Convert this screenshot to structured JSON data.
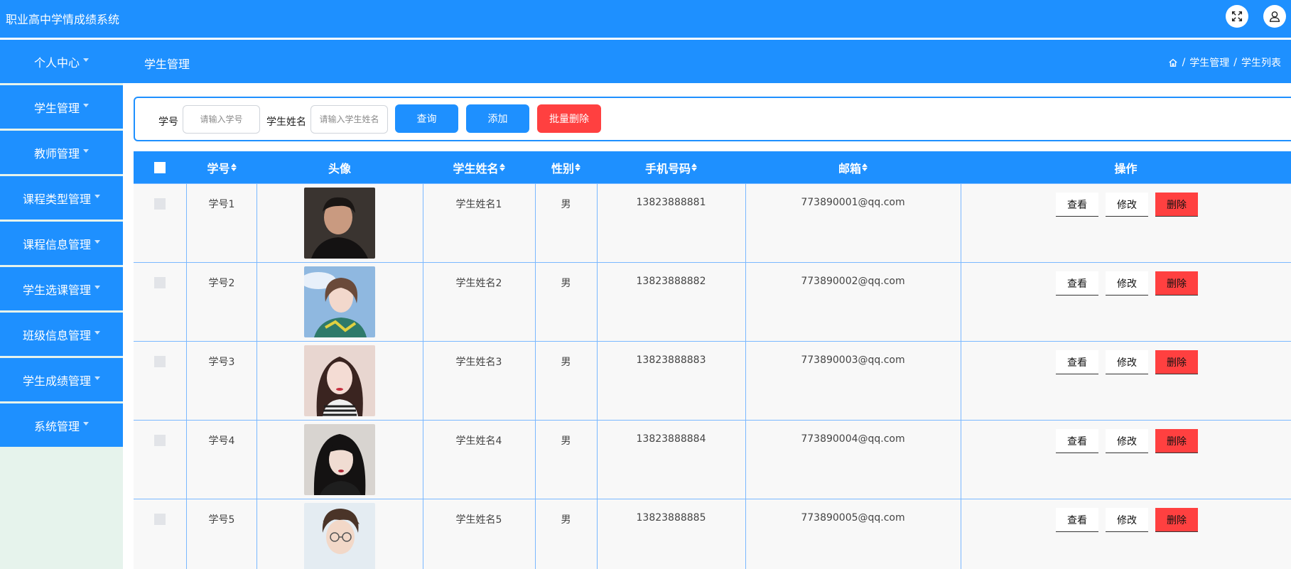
{
  "app": {
    "title": "职业高中学情成绩系统"
  },
  "header_icons": [
    "fullscreen-icon",
    "user-icon"
  ],
  "sidebar": {
    "items": [
      {
        "label": "个人中心"
      },
      {
        "label": "学生管理"
      },
      {
        "label": "教师管理"
      },
      {
        "label": "课程类型管理"
      },
      {
        "label": "课程信息管理"
      },
      {
        "label": "学生选课管理"
      },
      {
        "label": "班级信息管理"
      },
      {
        "label": "学生成绩管理"
      },
      {
        "label": "系统管理"
      }
    ]
  },
  "breadcrumb": {
    "title": "学生管理",
    "path": [
      "学生管理",
      "学生列表"
    ],
    "separator": "/"
  },
  "search": {
    "student_no_label": "学号",
    "student_no_placeholder": "请输入学号",
    "student_name_label": "学生姓名",
    "student_name_placeholder": "请输入学生姓名",
    "query_label": "查询",
    "add_label": "添加",
    "batch_delete_label": "批量删除"
  },
  "table": {
    "columns": [
      "学号",
      "头像",
      "学生姓名",
      "性别",
      "手机号码",
      "邮箱",
      "操作"
    ],
    "action_labels": {
      "view": "查看",
      "edit": "修改",
      "delete": "删除"
    },
    "rows": [
      {
        "student_no": "学号1",
        "name": "学生姓名1",
        "gender": "男",
        "phone": "13823888881",
        "email": "773890001@qq.com"
      },
      {
        "student_no": "学号2",
        "name": "学生姓名2",
        "gender": "男",
        "phone": "13823888882",
        "email": "773890002@qq.com"
      },
      {
        "student_no": "学号3",
        "name": "学生姓名3",
        "gender": "男",
        "phone": "13823888883",
        "email": "773890003@qq.com"
      },
      {
        "student_no": "学号4",
        "name": "学生姓名4",
        "gender": "男",
        "phone": "13823888884",
        "email": "773890004@qq.com"
      },
      {
        "student_no": "学号5",
        "name": "学生姓名5",
        "gender": "男",
        "phone": "13823888885",
        "email": "773890005@qq.com"
      }
    ]
  },
  "colors": {
    "primary": "#1e90ff",
    "danger": "#ff4040",
    "sidebar_bg": "#e6f3ec",
    "row_bg": "#f8f8f8"
  }
}
